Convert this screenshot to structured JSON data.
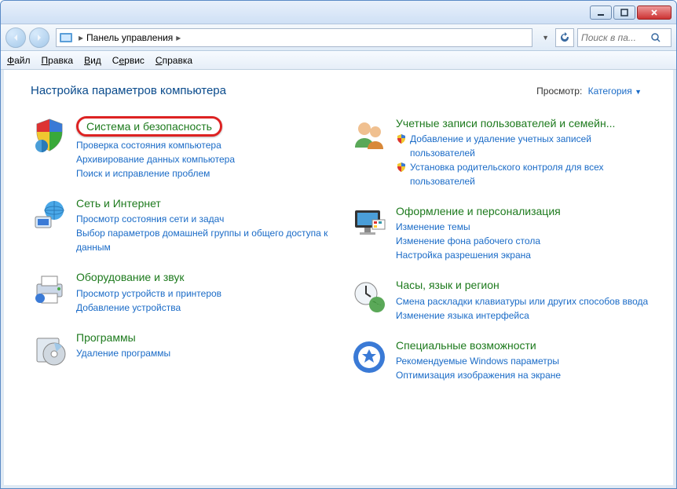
{
  "window": {
    "breadcrumb_root": "Панель управления",
    "search_placeholder": "Поиск в па..."
  },
  "menu": {
    "file": "Файл",
    "edit": "Правка",
    "view": "Вид",
    "tools": "Сервис",
    "help": "Справка"
  },
  "header": {
    "title": "Настройка параметров компьютера",
    "view_label": "Просмотр:",
    "view_value": "Категория"
  },
  "categories": {
    "system": {
      "title": "Система и безопасность",
      "links": [
        "Проверка состояния компьютера",
        "Архивирование данных компьютера",
        "Поиск и исправление проблем"
      ]
    },
    "network": {
      "title": "Сеть и Интернет",
      "links": [
        "Просмотр состояния сети и задач",
        "Выбор параметров домашней группы и общего доступа к данным"
      ]
    },
    "hardware": {
      "title": "Оборудование и звук",
      "links": [
        "Просмотр устройств и принтеров",
        "Добавление устройства"
      ]
    },
    "programs": {
      "title": "Программы",
      "links": [
        "Удаление программы"
      ]
    },
    "users": {
      "title": "Учетные записи пользователей и семейн...",
      "links": [
        "Добавление и удаление учетных записей пользователей",
        "Установка родительского контроля для всех пользователей"
      ],
      "shield": [
        true,
        true
      ]
    },
    "appearance": {
      "title": "Оформление и персонализация",
      "links": [
        "Изменение темы",
        "Изменение фона рабочего стола",
        "Настройка разрешения экрана"
      ]
    },
    "clock": {
      "title": "Часы, язык и регион",
      "links": [
        "Смена раскладки клавиатуры или других способов ввода",
        "Изменение языка интерфейса"
      ]
    },
    "ease": {
      "title": "Специальные возможности",
      "links": [
        "Рекомендуемые Windows параметры",
        "Оптимизация изображения на экране"
      ]
    }
  }
}
